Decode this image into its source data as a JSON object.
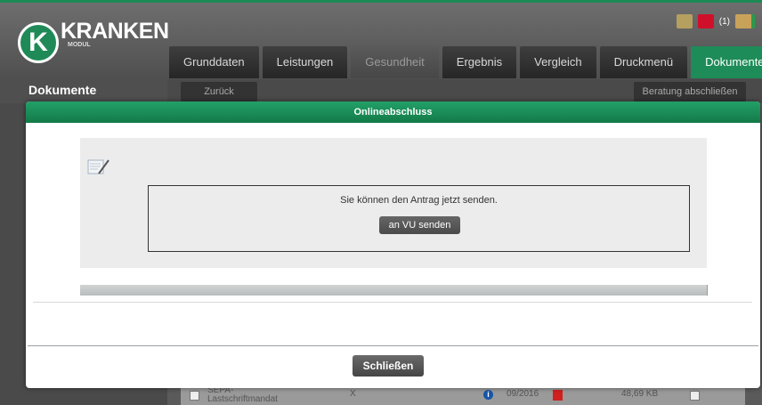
{
  "header": {
    "logo_letter": "K",
    "logo_word": "KRANKEN",
    "logo_sub": "MODUL",
    "notification_count": "(1)"
  },
  "tabs": [
    {
      "label": "Grunddaten",
      "state": "normal"
    },
    {
      "label": "Leistungen",
      "state": "normal"
    },
    {
      "label": "Gesundheit",
      "state": "dim"
    },
    {
      "label": "Ergebnis",
      "state": "normal"
    },
    {
      "label": "Vergleich",
      "state": "normal"
    },
    {
      "label": "Druckmenü",
      "state": "normal"
    },
    {
      "label": "Dokumente",
      "state": "active"
    }
  ],
  "sidebar": {
    "title": "Dokumente"
  },
  "toolbar": {
    "back_label": "Zurück",
    "finish_label": "Beratung abschließen"
  },
  "document_row": {
    "name": "SEPA-Lastschriftmandat",
    "mark": "X",
    "date": "09/2016",
    "size": "48,69 KB"
  },
  "modal": {
    "title": "Onlineabschluss",
    "message": "Sie können den Antrag jetzt senden.",
    "send_label": "an VU senden",
    "close_label": "Schließen"
  },
  "colors": {
    "accent_green": "#1d8c58",
    "header_dark": "#4f4f4f"
  }
}
